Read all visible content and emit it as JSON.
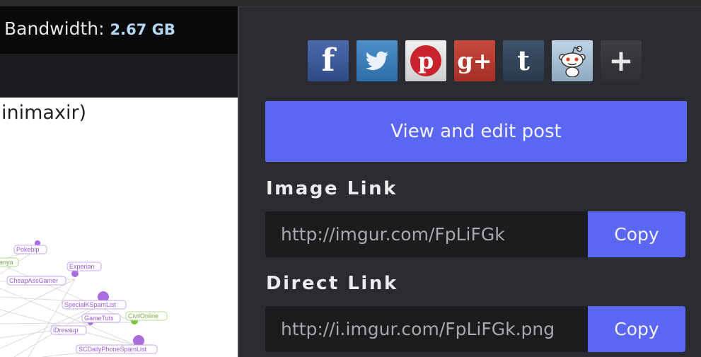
{
  "stats": {
    "bandwidth_label": "Bandwidth:",
    "bandwidth_value": "2.67 GB"
  },
  "image": {
    "title_fragment": "inimaxir)",
    "nodes": [
      "Pokebip",
      "anya",
      "Experian",
      "CheapAssGamer",
      "SpecialKSpamList",
      "CivilOnline",
      "GameTuts",
      "iDressup",
      "SCDailyPhoneSpamList"
    ]
  },
  "share": {
    "icons": [
      "facebook-icon",
      "twitter-icon",
      "pinterest-icon",
      "google-plus-icon",
      "tumblr-icon",
      "reddit-icon",
      "plus-icon"
    ],
    "glyphs": [
      "f",
      "t",
      "p",
      "g+",
      "t",
      "",
      "+"
    ]
  },
  "actions": {
    "view_edit_label": "View and edit post"
  },
  "image_link": {
    "label": "Image Link",
    "value": "http://imgur.com/FpLiFGk",
    "copy_label": "Copy"
  },
  "direct_link": {
    "label": "Direct Link",
    "value": "http://i.imgur.com/FpLiFGk.png",
    "copy_label": "Copy"
  },
  "colors": {
    "accent": "#5b66f2",
    "panel_bg": "#2b2c31",
    "field_bg": "#1c1c1f",
    "bandwidth_value": "#b5d8f7"
  }
}
